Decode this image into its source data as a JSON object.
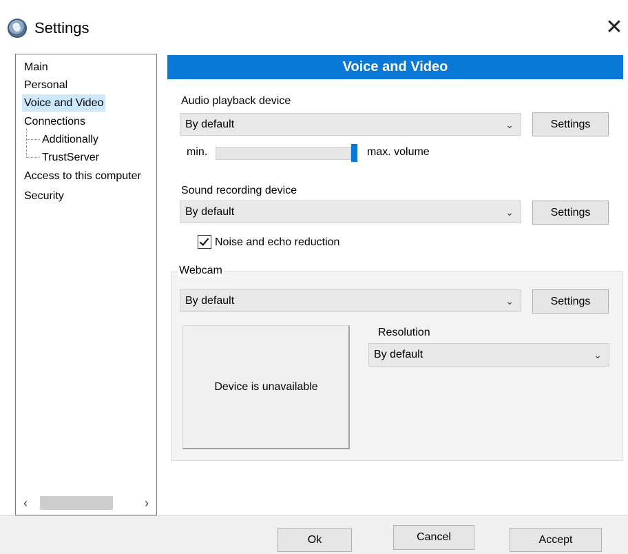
{
  "window": {
    "title": "Settings",
    "close_glyph": "✕"
  },
  "nav": {
    "items": [
      {
        "label": "Main"
      },
      {
        "label": "Personal"
      },
      {
        "label": "Voice and Video"
      },
      {
        "label": "Connections"
      },
      {
        "label": "Additionally"
      },
      {
        "label": "TrustServer"
      },
      {
        "label": "Access to this computer"
      },
      {
        "label": "Security"
      }
    ],
    "scroll_left": "‹",
    "scroll_right": "›"
  },
  "section": {
    "title": "Voice and Video"
  },
  "audio_playback": {
    "label": "Audio playback device",
    "value": "By default",
    "settings_label": "Settings",
    "volume_min_label": "min.",
    "volume_max_label": "max. volume",
    "volume_level": 1.0
  },
  "sound_recording": {
    "label": "Sound recording device",
    "value": "By default",
    "settings_label": "Settings",
    "noise_label": "Noise and echo reduction",
    "noise_checked": true
  },
  "webcam": {
    "group_label": "Webcam",
    "value": "By default",
    "settings_label": "Settings",
    "preview_text": "Device is unavailable",
    "resolution_label": "Resolution",
    "resolution_value": "By default"
  },
  "footer": {
    "ok_label": "Ok",
    "cancel_label": "Cancel",
    "accept_label": "Accept"
  },
  "colors": {
    "accent": "#0a78d7",
    "selection": "#cce8ff"
  },
  "icons": {
    "dropdown": "chevron-down-icon",
    "app": "settings-gear-icon"
  }
}
